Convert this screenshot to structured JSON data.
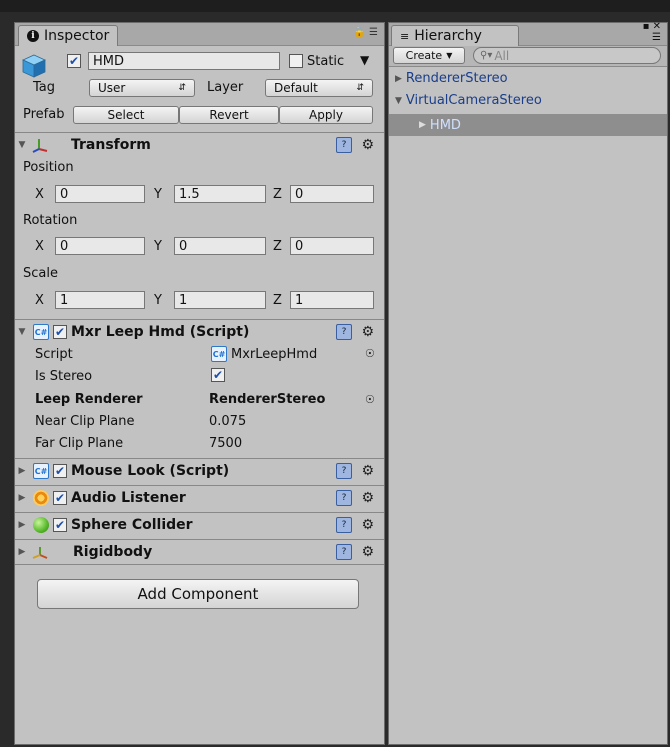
{
  "inspector": {
    "tab_label": "Inspector",
    "object": {
      "active_checked": true,
      "name": "HMD",
      "static_label": "Static",
      "tag_label": "Tag",
      "tag_value": "User",
      "layer_label": "Layer",
      "layer_value": "Default",
      "prefab_label": "Prefab",
      "select_label": "Select",
      "revert_label": "Revert",
      "apply_label": "Apply"
    },
    "transform": {
      "title": "Transform",
      "position_label": "Position",
      "rotation_label": "Rotation",
      "scale_label": "Scale",
      "x_label": "X",
      "y_label": "Y",
      "z_label": "Z",
      "position": {
        "x": "0",
        "y": "1.5",
        "z": "0"
      },
      "rotation": {
        "x": "0",
        "y": "0",
        "z": "0"
      },
      "scale": {
        "x": "1",
        "y": "1",
        "z": "1"
      }
    },
    "mxr": {
      "title": "Mxr Leep Hmd (Script)",
      "script_label": "Script",
      "script_value": "MxrLeepHmd",
      "stereo_label": "Is Stereo",
      "renderer_label": "Leep Renderer",
      "renderer_value": "RendererStereo",
      "near_label": "Near Clip Plane",
      "near_value": "0.075",
      "far_label": "Far Clip Plane",
      "far_value": "7500"
    },
    "components": [
      {
        "title": "Mouse Look (Script)"
      },
      {
        "title": "Audio Listener"
      },
      {
        "title": "Sphere Collider"
      },
      {
        "title": "Rigidbody"
      }
    ],
    "add_component_label": "Add Component"
  },
  "hierarchy": {
    "tab_label": "Hierarchy",
    "create_label": "Create",
    "search_placeholder": "All",
    "items": [
      {
        "label": "RendererStereo"
      },
      {
        "label": "VirtualCameraStereo"
      },
      {
        "label": "HMD"
      }
    ]
  },
  "colors": {
    "panel_bg": "#c2c2c2",
    "selection": "#8e8e8e",
    "hierarchy_text": "#1a3e8a",
    "selected_text": "#cfe0ff"
  }
}
